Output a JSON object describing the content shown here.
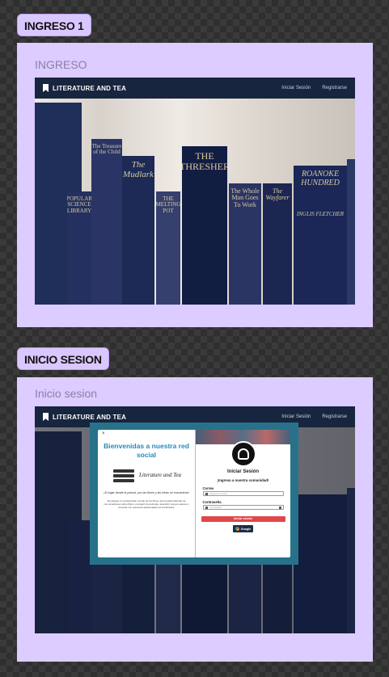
{
  "sections": {
    "ingreso": {
      "tag": "INGRESO 1",
      "frame_label": "INGRESO"
    },
    "inicio": {
      "tag": "INICIO SESION",
      "frame_label": "Inicio sesion"
    }
  },
  "navbar": {
    "brand": "LITERATURE AND TEA",
    "links": [
      "Iniciar Sesión",
      "Registrarse"
    ]
  },
  "books": [
    {
      "title": "The Treasure of the Child"
    },
    {
      "title": "POPULAR SCIENCE LIBRARY"
    },
    {
      "title": "The Mudlark"
    },
    {
      "title": "THE MELTING POT"
    },
    {
      "title": "THE THRESHER"
    },
    {
      "title": "The Whole Man Goes To Work"
    },
    {
      "title": "The Wayfarer"
    },
    {
      "title": "ROANOKE HUNDRED"
    },
    {
      "title": "INGLIS FLETCHER"
    }
  ],
  "modal": {
    "close": "×",
    "welcome": "Bienvenidas a nuestra red social",
    "logo": "Literature and Tea",
    "quote": "¡El lugar donde la poesía, por las flores y las letras se encuentran!",
    "description": "Sumérgete en el fascinante mundo de los libros. Aquí podrás disfrutar de conversaciones sobre libros, compartir tus lecturas, descubrir nuevos autores y conectar con personas apasionadas por la literatura.",
    "login_title": "Iniciar Sesión",
    "join_text": "¡Ingresa a nuestra comunidad!",
    "email_label": "Correo",
    "email_placeholder": "Ingresa tu correo",
    "password_label": "Contraseña",
    "password_placeholder": "Contraseña",
    "login_button": "Iniciar sesión",
    "google_button": "Google"
  },
  "colors": {
    "frame": "#dcccff",
    "navbar": "#17253e",
    "modal_border": "#27728a",
    "welcome": "#1e8dbd",
    "login_button": "#e04848"
  }
}
